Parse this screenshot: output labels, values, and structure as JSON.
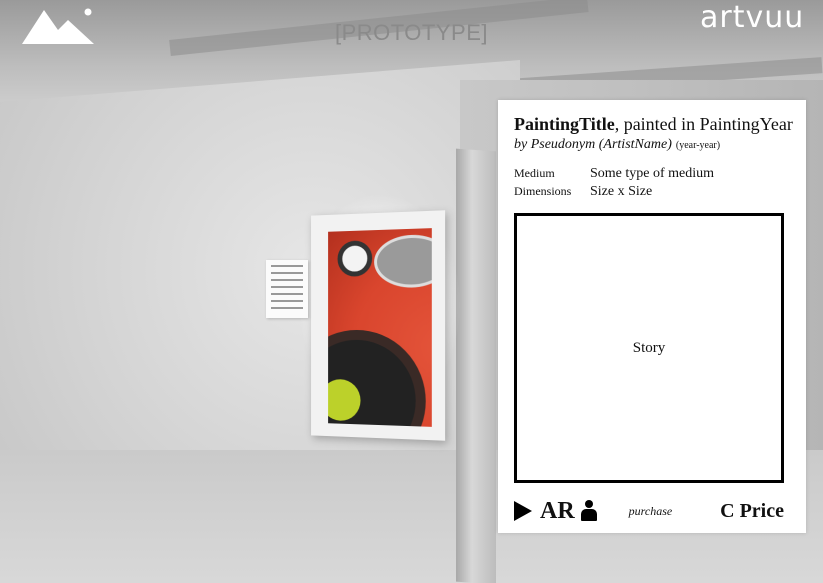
{
  "header": {
    "logo_icon": "mountain-logo-icon",
    "prototype_label": "[PROTOTYPE]",
    "brand": "artvuu"
  },
  "artwork": {
    "title": "PaintingTitle",
    "painted_in": ", painted in PaintingYear",
    "artist": "by Pseudonym (ArtistName)",
    "years": "(year-year)",
    "medium_label": "Medium",
    "medium_value": "Some type of medium",
    "dimensions_label": "Dimensions",
    "dimensions_value": "Size x Size",
    "story": "Story"
  },
  "actions": {
    "play_icon": "play-icon",
    "ar_label": "AR",
    "person_icon": "person-icon",
    "purchase_label": "purchase",
    "price_label": "C Price"
  }
}
